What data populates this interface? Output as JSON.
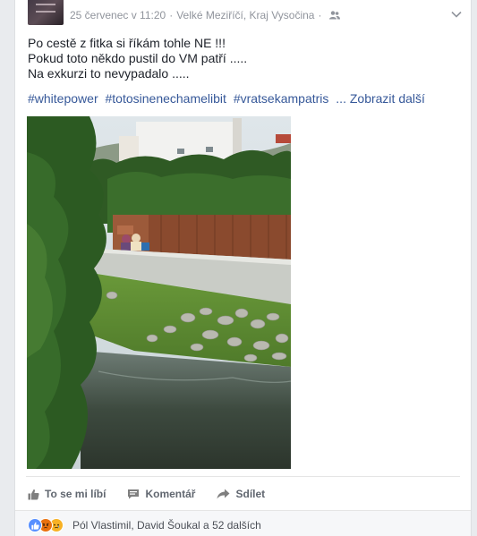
{
  "post": {
    "meta": {
      "date": "25 červenec v 11:20",
      "separator": "·",
      "location": "Velké Meziříčí, Kraj Vysočina",
      "audience_icon": "friends-icon"
    },
    "text_lines": [
      "Po cestě z fitka si říkám tohle NE !!!",
      "Pokud toto někdo pustil do VM patří .....",
      "Na exkurzi to nevypadalo ....."
    ],
    "hashtags": [
      "#whitepower",
      "#totosinenechamelibit",
      "#vratsekampatris"
    ],
    "see_more": "... Zobrazit další"
  },
  "actions": {
    "like": "To se mi líbí",
    "comment": "Komentář",
    "share": "Sdílet"
  },
  "reactions": {
    "icons": [
      "like-icon",
      "angry-icon",
      "sad-icon"
    ],
    "summary": "Pól Vlastimil, David Šoukal a 52 dalších"
  },
  "colors": {
    "link": "#365899",
    "meta": "#90949c",
    "action": "#616770",
    "like": "#5890ff",
    "angry": "#e9710f",
    "sad": "#f7b125"
  }
}
